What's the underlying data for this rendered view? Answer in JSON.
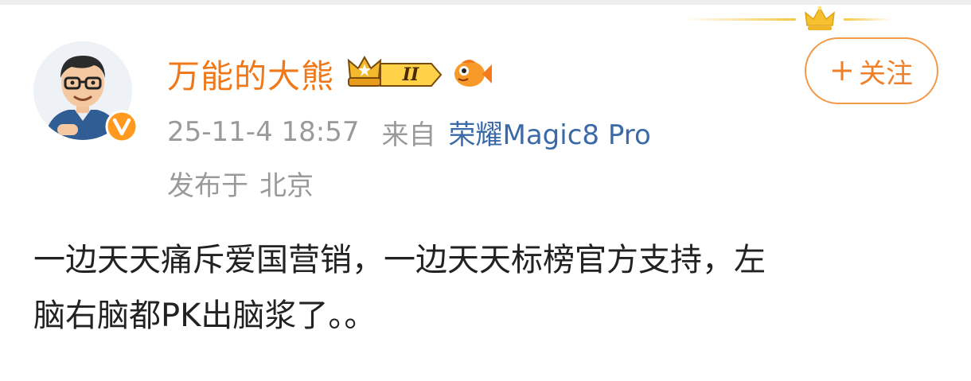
{
  "user": {
    "name": "万能的大熊",
    "level_badge_text": "II"
  },
  "follow_button": {
    "plus": "+",
    "label": "关注"
  },
  "meta": {
    "timestamp": "25-11-4 18:57",
    "from_label": "来自",
    "device": "荣耀Magic8 Pro",
    "location_prefix": "发布于",
    "location": "北京"
  },
  "post": {
    "lines": [
      "一边天天痛斥爱国营销，一边天天标榜官方支持，左",
      "脑右脑都PK出脑浆了。。"
    ]
  },
  "icons": {
    "avatar": "cartoon-avatar",
    "verify": "verified-v-icon",
    "crown_badge": "crown-level-badge-icon",
    "fish": "fish-icon",
    "decoration": "crown-decoration-icon"
  },
  "colors": {
    "username": "#f07818",
    "follow": "#f07f2a",
    "device_link": "#3a6aa8",
    "meta_gray": "#9a9a9a",
    "body_text": "#222222"
  }
}
